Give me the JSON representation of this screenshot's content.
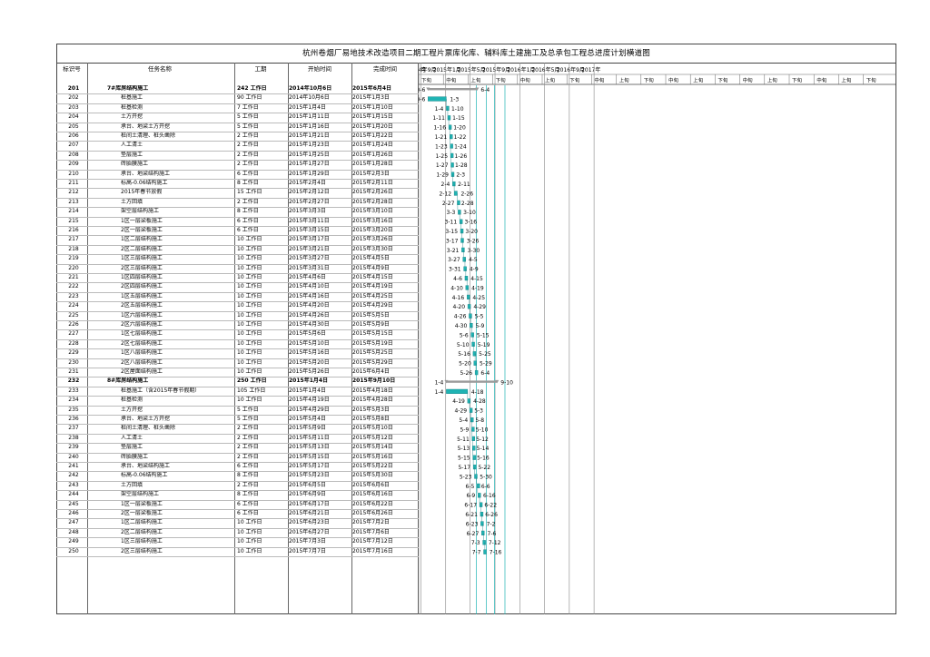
{
  "title": "杭州卷烟厂易地技术改造项目二期工程片票库化库、辅料库土建施工及总承包工程总进度计划横道图",
  "columns": {
    "id": "标识号",
    "name": "任务名称",
    "duration": "工期",
    "start": "开始时间",
    "end": "完成时间"
  },
  "timeline": {
    "top_labels": [
      "月",
      "2014年9月",
      "2015年1月",
      "2015年5月",
      "2015年9月",
      "2016年1月",
      "2016年5月",
      "2016年9月",
      "2017年"
    ],
    "sub_labels": [
      "下旬",
      "中旬",
      "上旬",
      "下旬",
      "中旬",
      "上旬",
      "下旬",
      "中旬",
      "上旬",
      "下旬",
      "中旬",
      "上旬",
      "下旬",
      "中旬",
      "上旬",
      "下旬",
      "中旬",
      "上旬",
      "下旬"
    ]
  },
  "chart_data": {
    "type": "gantt",
    "tasks": [
      {
        "id": "201",
        "name": "7#库房结构施工",
        "duration": "242 工作日",
        "start": "2014年10月6日",
        "end": "2015年6月4日",
        "summary": true,
        "s_lbl": "10-6",
        "e_lbl": "6-4"
      },
      {
        "id": "202",
        "name": "桩基施工",
        "duration": "90 工作日",
        "start": "2014年10月6日",
        "end": "2015年1月3日",
        "s_lbl": "10-6",
        "e_lbl": "1-3"
      },
      {
        "id": "203",
        "name": "桩基检测",
        "duration": "7 工作日",
        "start": "2015年1月4日",
        "end": "2015年1月10日",
        "s_lbl": "1-4",
        "e_lbl": "1-10"
      },
      {
        "id": "204",
        "name": "土方开挖",
        "duration": "5 工作日",
        "start": "2015年1月11日",
        "end": "2015年1月15日",
        "s_lbl": "1-11",
        "e_lbl": "1-15"
      },
      {
        "id": "205",
        "name": "承台、地梁土方开挖",
        "duration": "5 工作日",
        "start": "2015年1月16日",
        "end": "2015年1月20日",
        "s_lbl": "1-16",
        "e_lbl": "1-20"
      },
      {
        "id": "206",
        "name": "桩间土清理、桩头凿除",
        "duration": "2 工作日",
        "start": "2015年1月21日",
        "end": "2015年1月22日",
        "s_lbl": "1-21",
        "e_lbl": "1-22"
      },
      {
        "id": "207",
        "name": "人工清土",
        "duration": "2 工作日",
        "start": "2015年1月23日",
        "end": "2015年1月24日",
        "s_lbl": "1-23",
        "e_lbl": "1-24"
      },
      {
        "id": "208",
        "name": "垫层施工",
        "duration": "2 工作日",
        "start": "2015年1月25日",
        "end": "2015年1月26日",
        "s_lbl": "1-25",
        "e_lbl": "1-26"
      },
      {
        "id": "209",
        "name": "砖胎膜施工",
        "duration": "2 工作日",
        "start": "2015年1月27日",
        "end": "2015年1月28日",
        "s_lbl": "1-27",
        "e_lbl": "1-28"
      },
      {
        "id": "210",
        "name": "承台、地梁结构施工",
        "duration": "6 工作日",
        "start": "2015年1月29日",
        "end": "2015年2月3日",
        "s_lbl": "1-29",
        "e_lbl": "2-3"
      },
      {
        "id": "211",
        "name": "标高-0.06结构施工",
        "duration": "8 工作日",
        "start": "2015年2月4日",
        "end": "2015年2月11日",
        "s_lbl": "2-4",
        "e_lbl": "2-11"
      },
      {
        "id": "212",
        "name": "2015年春节放假",
        "duration": "15 工作日",
        "start": "2015年2月12日",
        "end": "2015年2月26日",
        "s_lbl": "2-12",
        "e_lbl": "2-26"
      },
      {
        "id": "213",
        "name": "土方回填",
        "duration": "2 工作日",
        "start": "2015年2月27日",
        "end": "2015年2月28日",
        "s_lbl": "2-27",
        "e_lbl": "2-28"
      },
      {
        "id": "214",
        "name": "架空层结构施工",
        "duration": "8 工作日",
        "start": "2015年3月3日",
        "end": "2015年3月10日",
        "s_lbl": "3-3",
        "e_lbl": "3-10"
      },
      {
        "id": "215",
        "name": "1区一层梁板施工",
        "duration": "6 工作日",
        "start": "2015年3月11日",
        "end": "2015年3月16日",
        "s_lbl": "3-11",
        "e_lbl": "3-16"
      },
      {
        "id": "216",
        "name": "2区一层梁板施工",
        "duration": "6 工作日",
        "start": "2015年3月15日",
        "end": "2015年3月20日",
        "s_lbl": "3-15",
        "e_lbl": "3-20"
      },
      {
        "id": "217",
        "name": "1区二层结构施工",
        "duration": "10 工作日",
        "start": "2015年3月17日",
        "end": "2015年3月26日",
        "s_lbl": "3-17",
        "e_lbl": "3-26"
      },
      {
        "id": "218",
        "name": "2区二层结构施工",
        "duration": "10 工作日",
        "start": "2015年3月21日",
        "end": "2015年3月30日",
        "s_lbl": "3-21",
        "e_lbl": "3-30"
      },
      {
        "id": "219",
        "name": "1区三层结构施工",
        "duration": "10 工作日",
        "start": "2015年3月27日",
        "end": "2015年4月5日",
        "s_lbl": "3-27",
        "e_lbl": "4-5"
      },
      {
        "id": "220",
        "name": "2区三层结构施工",
        "duration": "10 工作日",
        "start": "2015年3月31日",
        "end": "2015年4月9日",
        "s_lbl": "3-31",
        "e_lbl": "4-9"
      },
      {
        "id": "221",
        "name": "1区四层结构施工",
        "duration": "10 工作日",
        "start": "2015年4月6日",
        "end": "2015年4月15日",
        "s_lbl": "4-6",
        "e_lbl": "4-15"
      },
      {
        "id": "222",
        "name": "2区四层结构施工",
        "duration": "10 工作日",
        "start": "2015年4月10日",
        "end": "2015年4月19日",
        "s_lbl": "4-10",
        "e_lbl": "4-19"
      },
      {
        "id": "223",
        "name": "1区五层结构施工",
        "duration": "10 工作日",
        "start": "2015年4月16日",
        "end": "2015年4月25日",
        "s_lbl": "4-16",
        "e_lbl": "4-25"
      },
      {
        "id": "224",
        "name": "2区五层结构施工",
        "duration": "10 工作日",
        "start": "2015年4月20日",
        "end": "2015年4月29日",
        "s_lbl": "4-20",
        "e_lbl": "4-29"
      },
      {
        "id": "225",
        "name": "1区六层结构施工",
        "duration": "10 工作日",
        "start": "2015年4月26日",
        "end": "2015年5月5日",
        "s_lbl": "4-26",
        "e_lbl": "5-5"
      },
      {
        "id": "226",
        "name": "2区六层结构施工",
        "duration": "10 工作日",
        "start": "2015年4月30日",
        "end": "2015年5月9日",
        "s_lbl": "4-30",
        "e_lbl": "5-9"
      },
      {
        "id": "227",
        "name": "1区七层结构施工",
        "duration": "10 工作日",
        "start": "2015年5月6日",
        "end": "2015年5月15日",
        "s_lbl": "5-6",
        "e_lbl": "5-15"
      },
      {
        "id": "228",
        "name": "2区七层结构施工",
        "duration": "10 工作日",
        "start": "2015年5月10日",
        "end": "2015年5月19日",
        "s_lbl": "5-10",
        "e_lbl": "5-19"
      },
      {
        "id": "229",
        "name": "1区八层结构施工",
        "duration": "10 工作日",
        "start": "2015年5月16日",
        "end": "2015年5月25日",
        "s_lbl": "5-16",
        "e_lbl": "5-25"
      },
      {
        "id": "230",
        "name": "2区八层结构施工",
        "duration": "10 工作日",
        "start": "2015年5月20日",
        "end": "2015年5月29日",
        "s_lbl": "5-20",
        "e_lbl": "5-29"
      },
      {
        "id": "231",
        "name": "2区屋面结构施工",
        "duration": "10 工作日",
        "start": "2015年5月26日",
        "end": "2015年6月4日",
        "s_lbl": "5-26",
        "e_lbl": "6-4"
      },
      {
        "id": "232",
        "name": "8#库房结构施工",
        "duration": "250 工作日",
        "start": "2015年1月4日",
        "end": "2015年9月10日",
        "summary": true,
        "s_lbl": "1-4",
        "e_lbl": "9-10"
      },
      {
        "id": "233",
        "name": "桩基施工（含2015年春节假期）",
        "duration": "105 工作日",
        "start": "2015年1月4日",
        "end": "2015年4月18日",
        "s_lbl": "1-4",
        "e_lbl": "4-18"
      },
      {
        "id": "234",
        "name": "桩基检测",
        "duration": "10 工作日",
        "start": "2015年4月19日",
        "end": "2015年4月28日",
        "s_lbl": "4-19",
        "e_lbl": "4-28"
      },
      {
        "id": "235",
        "name": "土方开挖",
        "duration": "5 工作日",
        "start": "2015年4月29日",
        "end": "2015年5月3日",
        "s_lbl": "4-29",
        "e_lbl": "5-3"
      },
      {
        "id": "236",
        "name": "承台、地梁土方开挖",
        "duration": "5 工作日",
        "start": "2015年5月4日",
        "end": "2015年5月8日",
        "s_lbl": "5-4",
        "e_lbl": "5-8"
      },
      {
        "id": "237",
        "name": "桩间土清理、桩头凿除",
        "duration": "2 工作日",
        "start": "2015年5月9日",
        "end": "2015年5月10日",
        "s_lbl": "5-9",
        "e_lbl": "5-10"
      },
      {
        "id": "238",
        "name": "人工清土",
        "duration": "2 工作日",
        "start": "2015年5月11日",
        "end": "2015年5月12日",
        "s_lbl": "5-11",
        "e_lbl": "5-12"
      },
      {
        "id": "239",
        "name": "垫层施工",
        "duration": "2 工作日",
        "start": "2015年5月13日",
        "end": "2015年5月14日",
        "s_lbl": "5-13",
        "e_lbl": "5-14"
      },
      {
        "id": "240",
        "name": "砖胎膜施工",
        "duration": "2 工作日",
        "start": "2015年5月15日",
        "end": "2015年5月16日",
        "s_lbl": "5-15",
        "e_lbl": "5-16"
      },
      {
        "id": "241",
        "name": "承台、地梁结构施工",
        "duration": "6 工作日",
        "start": "2015年5月17日",
        "end": "2015年5月22日",
        "s_lbl": "5-17",
        "e_lbl": "5-22"
      },
      {
        "id": "242",
        "name": "标高-0.06结构施工",
        "duration": "8 工作日",
        "start": "2015年5月23日",
        "end": "2015年5月30日",
        "s_lbl": "5-23",
        "e_lbl": "5-30"
      },
      {
        "id": "243",
        "name": "土方回填",
        "duration": "2 工作日",
        "start": "2015年6月5日",
        "end": "2015年6月6日",
        "s_lbl": "6-5",
        "e_lbl": "6-6"
      },
      {
        "id": "244",
        "name": "架空层结构施工",
        "duration": "8 工作日",
        "start": "2015年6月9日",
        "end": "2015年6月16日",
        "s_lbl": "6-9",
        "e_lbl": "6-16"
      },
      {
        "id": "245",
        "name": "1区一层梁板施工",
        "duration": "6 工作日",
        "start": "2015年6月17日",
        "end": "2015年6月22日",
        "s_lbl": "6-17",
        "e_lbl": "6-22"
      },
      {
        "id": "246",
        "name": "2区一层梁板施工",
        "duration": "6 工作日",
        "start": "2015年6月21日",
        "end": "2015年6月26日",
        "s_lbl": "6-21",
        "e_lbl": "6-26"
      },
      {
        "id": "247",
        "name": "1区二层结构施工",
        "duration": "10 工作日",
        "start": "2015年6月23日",
        "end": "2015年7月2日",
        "s_lbl": "6-23",
        "e_lbl": "7-2"
      },
      {
        "id": "248",
        "name": "2区二层结构施工",
        "duration": "10 工作日",
        "start": "2015年6月27日",
        "end": "2015年7月6日",
        "s_lbl": "6-27",
        "e_lbl": "7-6"
      },
      {
        "id": "249",
        "name": "1区三层结构施工",
        "duration": "10 工作日",
        "start": "2015年7月3日",
        "end": "2015年7月12日",
        "s_lbl": "7-3",
        "e_lbl": "7-12"
      },
      {
        "id": "250",
        "name": "2区三层结构施工",
        "duration": "10 工作日",
        "start": "2015年7月7日",
        "end": "2015年7月16日",
        "s_lbl": "7-7",
        "e_lbl": "7-16"
      }
    ],
    "axis": {
      "unit": "date",
      "start": "2014-08-21",
      "end": "2017-09-30"
    },
    "colors": {
      "bar": "#1fb3b3",
      "bar_dark": "#147f82",
      "summary": "#9a9a9a",
      "milestone_line": "#1fb3b3",
      "grid": "#777"
    }
  }
}
